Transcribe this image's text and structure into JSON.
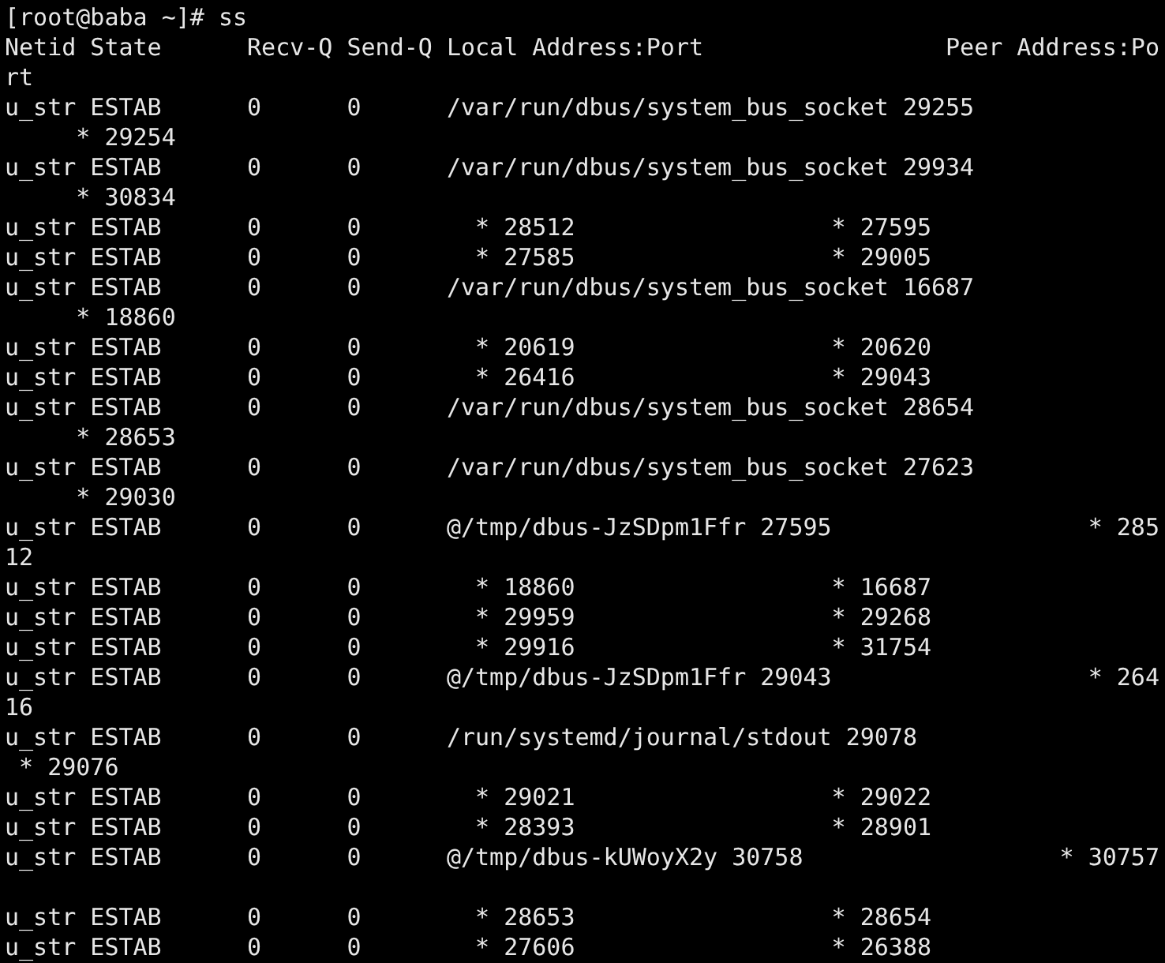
{
  "terminal": {
    "lines": [
      {
        "kind": "text",
        "text": "[root@baba ~]# ss"
      },
      {
        "kind": "text",
        "text": "Netid State      Recv-Q Send-Q Local Address:Port                 Peer Address:Po"
      },
      {
        "kind": "text",
        "text": "rt"
      },
      {
        "kind": "text",
        "text": "u_str ESTAB      0      0      /var/run/dbus/system_bus_socket 29255"
      },
      {
        "kind": "text",
        "text": "     * 29254"
      },
      {
        "kind": "text",
        "text": "u_str ESTAB      0      0      /var/run/dbus/system_bus_socket 29934"
      },
      {
        "kind": "text",
        "text": "     * 30834"
      },
      {
        "kind": "text",
        "text": "u_str ESTAB      0      0        * 28512                  * 27595"
      },
      {
        "kind": "text",
        "text": "u_str ESTAB      0      0        * 27585                  * 29005"
      },
      {
        "kind": "text",
        "text": "u_str ESTAB      0      0      /var/run/dbus/system_bus_socket 16687"
      },
      {
        "kind": "text",
        "text": "     * 18860"
      },
      {
        "kind": "text",
        "text": "u_str ESTAB      0      0        * 20619                  * 20620"
      },
      {
        "kind": "text",
        "text": "u_str ESTAB      0      0        * 26416                  * 29043"
      },
      {
        "kind": "text",
        "text": "u_str ESTAB      0      0      /var/run/dbus/system_bus_socket 28654"
      },
      {
        "kind": "text",
        "text": "     * 28653"
      },
      {
        "kind": "text",
        "text": "u_str ESTAB      0      0      /var/run/dbus/system_bus_socket 27623"
      },
      {
        "kind": "text",
        "text": "     * 29030"
      },
      {
        "kind": "text",
        "text": "u_str ESTAB      0      0      @/tmp/dbus-JzSDpm1Ffr 27595                  * 285"
      },
      {
        "kind": "text",
        "text": "12"
      },
      {
        "kind": "text",
        "text": "u_str ESTAB      0      0        * 18860                  * 16687"
      },
      {
        "kind": "text",
        "text": "u_str ESTAB      0      0        * 29959                  * 29268"
      },
      {
        "kind": "text",
        "text": "u_str ESTAB      0      0        * 29916                  * 31754"
      },
      {
        "kind": "text",
        "text": "u_str ESTAB      0      0      @/tmp/dbus-JzSDpm1Ffr 29043                  * 264"
      },
      {
        "kind": "text",
        "text": "16"
      },
      {
        "kind": "text",
        "text": "u_str ESTAB      0      0      /run/systemd/journal/stdout 29078"
      },
      {
        "kind": "text",
        "text": " * 29076"
      },
      {
        "kind": "text",
        "text": "u_str ESTAB      0      0        * 29021                  * 29022"
      },
      {
        "kind": "text",
        "text": "u_str ESTAB      0      0        * 28393                  * 28901"
      },
      {
        "kind": "text",
        "text": "u_str ESTAB      0      0      @/tmp/dbus-kUWoyX2y 30758                  * 30757"
      },
      {
        "kind": "blank"
      },
      {
        "kind": "text",
        "text": "u_str ESTAB      0      0        * 28653                  * 28654"
      },
      {
        "kind": "text",
        "text": "u_str ESTAB      0      0        * 27606                  * 26388"
      }
    ]
  }
}
